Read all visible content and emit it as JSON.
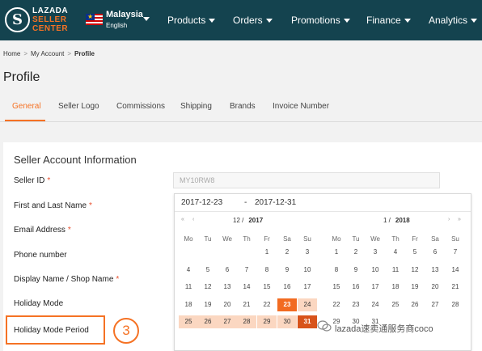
{
  "topbar": {
    "logo_letter": "S",
    "logo_lines": [
      "LAZADA",
      "SELLER",
      "CENTER"
    ],
    "country": "Malaysia",
    "language": "English",
    "nav": [
      "Products",
      "Orders",
      "Promotions",
      "Finance",
      "Analytics"
    ]
  },
  "breadcrumb": [
    "Home",
    "My Account",
    "Profile"
  ],
  "page_title": "Profile",
  "tabs": [
    "General",
    "Seller Logo",
    "Commissions",
    "Shipping",
    "Brands",
    "Invoice Number"
  ],
  "card": {
    "title": "Seller Account Information",
    "fields": [
      "Seller ID",
      "First and Last Name",
      "Email Address",
      "Phone number",
      "Display Name / Shop Name",
      "Holiday Mode",
      "Holiday Mode Period"
    ],
    "required_mark": "*",
    "seller_id_value": "MY10RW8"
  },
  "picker": {
    "start": "2017-12-23",
    "dash": "-",
    "end": "2017-12-31",
    "left": {
      "month": "12 /",
      "year": "2017",
      "weekdays": [
        "Mo",
        "Tu",
        "We",
        "Th",
        "Fr",
        "Sa",
        "Su"
      ],
      "rows": [
        [
          "",
          "",
          "",
          "",
          "1",
          "2",
          "3"
        ],
        [
          "4",
          "5",
          "6",
          "7",
          "8",
          "9",
          "10"
        ],
        [
          "11",
          "12",
          "13",
          "14",
          "15",
          "16",
          "17"
        ],
        [
          "18",
          "19",
          "20",
          "21",
          "22",
          "23",
          "24"
        ],
        [
          "25",
          "26",
          "27",
          "28",
          "29",
          "30",
          "31"
        ]
      ]
    },
    "right": {
      "month": "1 /",
      "year": "2018",
      "weekdays": [
        "Mo",
        "Tu",
        "We",
        "Th",
        "Fr",
        "Sa",
        "Su"
      ],
      "rows": [
        [
          "1",
          "2",
          "3",
          "4",
          "5",
          "6",
          "7"
        ],
        [
          "8",
          "9",
          "10",
          "11",
          "12",
          "13",
          "14"
        ],
        [
          "15",
          "16",
          "17",
          "18",
          "19",
          "20",
          "21"
        ],
        [
          "22",
          "23",
          "24",
          "25",
          "26",
          "27",
          "28"
        ],
        [
          "29",
          "30",
          "31",
          "",
          "",
          "",
          ""
        ]
      ]
    },
    "nav_prev_year": "«",
    "nav_prev_month": "‹",
    "nav_next_month": "›",
    "nav_next_year": "»"
  },
  "annotation_number": "3",
  "watermark": "lazada速卖通服务商coco",
  "colors": {
    "topbar": "#14434f",
    "accent": "#f57224",
    "range": "#fbd7c1"
  }
}
